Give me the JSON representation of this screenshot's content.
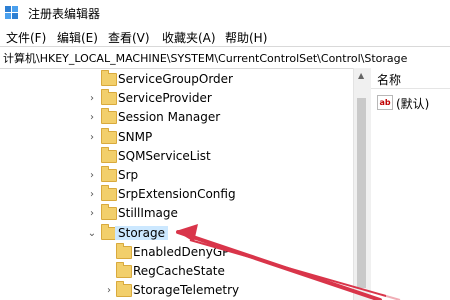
{
  "window": {
    "title": "注册表编辑器"
  },
  "menu": [
    "文件(F)",
    "编辑(E)",
    "查看(V)",
    "收藏夹(A)",
    "帮助(H)"
  ],
  "address": "计算机\\HKEY_LOCAL_MACHINE\\SYSTEM\\CurrentControlSet\\Control\\Storage",
  "tree": {
    "items": [
      {
        "label": "ServiceGroupOrder",
        "expander": "",
        "level": 1,
        "selected": false
      },
      {
        "label": "ServiceProvider",
        "expander": ">",
        "level": 1,
        "selected": false
      },
      {
        "label": "Session Manager",
        "expander": ">",
        "level": 1,
        "selected": false
      },
      {
        "label": "SNMP",
        "expander": ">",
        "level": 1,
        "selected": false
      },
      {
        "label": "SQMServiceList",
        "expander": "",
        "level": 1,
        "selected": false
      },
      {
        "label": "Srp",
        "expander": ">",
        "level": 1,
        "selected": false
      },
      {
        "label": "SrpExtensionConfig",
        "expander": ">",
        "level": 1,
        "selected": false
      },
      {
        "label": "StillImage",
        "expander": ">",
        "level": 1,
        "selected": false
      },
      {
        "label": "Storage",
        "expander": "v",
        "level": 1,
        "selected": true
      },
      {
        "label": "EnabledDenyGP",
        "expander": "",
        "level": 2,
        "selected": false
      },
      {
        "label": "RegCacheState",
        "expander": "",
        "level": 2,
        "selected": false
      },
      {
        "label": "StorageTelemetry",
        "expander": ">",
        "level": 2,
        "selected": false
      }
    ]
  },
  "values_pane": {
    "header": "名称",
    "items": [
      {
        "type_icon": "ab",
        "name": "(默认)"
      }
    ]
  },
  "colors": {
    "selection": "#cce8ff",
    "annotation_arrow": "#d9354a",
    "folder": "#f2cf6b"
  }
}
